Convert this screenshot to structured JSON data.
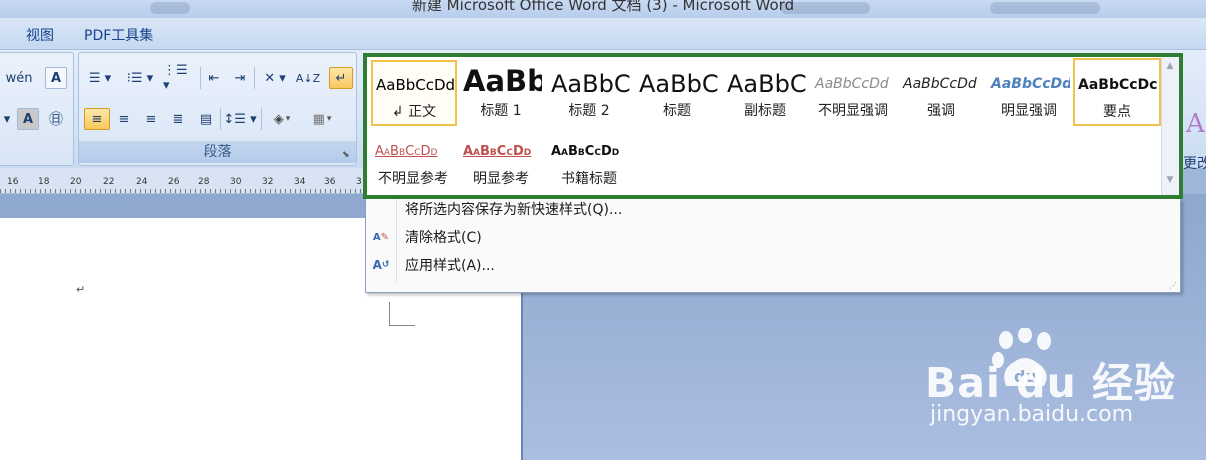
{
  "window": {
    "title": "新建 Microsoft Office Word 文档 (3) - Microsoft Word"
  },
  "tabs": [
    "视图",
    "PDF工具集"
  ],
  "ribbon": {
    "paragraph_group_label": "段落",
    "change_styles_label": "更改"
  },
  "ruler": {
    "numbers": [
      "16",
      "18",
      "20",
      "22",
      "24",
      "26",
      "28",
      "30",
      "32",
      "34",
      "36",
      "3"
    ]
  },
  "document": {
    "paragraph_mark": "↵"
  },
  "styles": [
    {
      "sample": "AaBbCcDd",
      "label": "↲ 正文",
      "state": "selected"
    },
    {
      "sample": "AaBb",
      "label": "标题 1"
    },
    {
      "sample": "AaBbC",
      "label": "标题 2"
    },
    {
      "sample": "AaBbC",
      "label": "标题"
    },
    {
      "sample": "AaBbC",
      "label": "副标题"
    },
    {
      "sample": "AaBbCcDd",
      "label": "不明显强调"
    },
    {
      "sample": "AaBbCcDd",
      "label": "强调"
    },
    {
      "sample": "AaBbCcDd",
      "label": "明显强调"
    },
    {
      "sample": "AaBbCcDc",
      "label": "要点",
      "state": "highlighted"
    },
    {
      "sample": "AaBbCcDd",
      "label": "不明显参考"
    },
    {
      "sample": "AaBbCcDd",
      "label": "明显参考"
    },
    {
      "sample": "AaBbCcDd",
      "label": "书籍标题"
    }
  ],
  "menu": [
    {
      "label": "将所选内容保存为新快速样式(Q)...",
      "icon": "none"
    },
    {
      "label": "清除格式(C)",
      "icon": "clear-format-icon"
    },
    {
      "label": "应用样式(A)...",
      "icon": "apply-styles-icon"
    }
  ],
  "watermark": {
    "logo": "Bai  du 经验",
    "url": "jingyan.baidu.com"
  },
  "colors": {
    "highlight_frame": "#2e7d32",
    "selected_tile": "#f0c24b",
    "ribbon": "#d6e4f6"
  }
}
